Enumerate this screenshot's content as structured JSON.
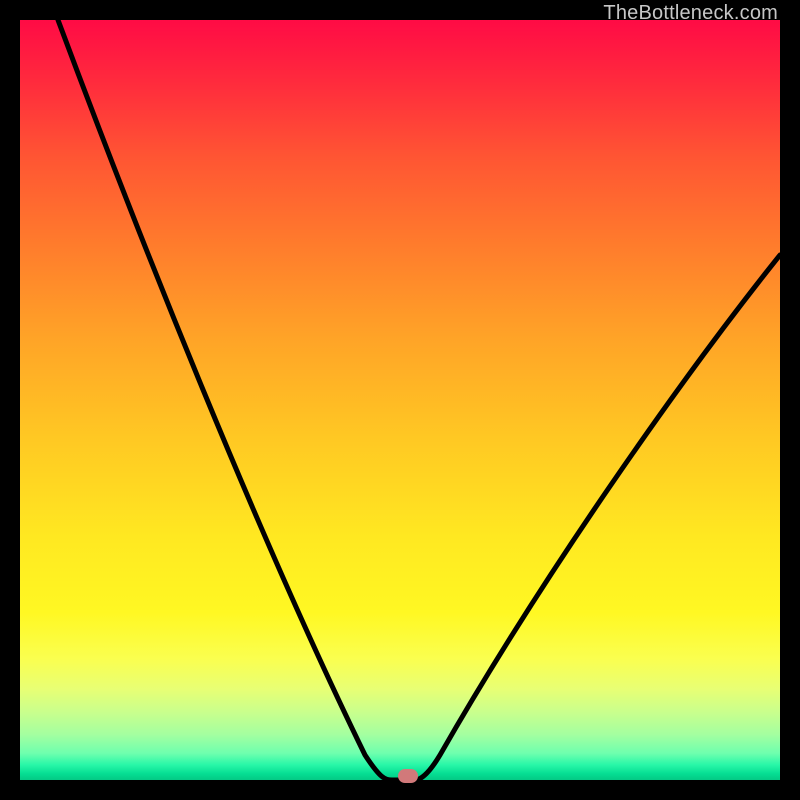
{
  "watermark": "TheBottleneck.com",
  "chart_data": {
    "type": "line",
    "title": "",
    "xlabel": "",
    "ylabel": "",
    "xlim": [
      0,
      100
    ],
    "ylim": [
      0,
      100
    ],
    "series": [
      {
        "name": "curve",
        "x": [
          5,
          10,
          15,
          20,
          25,
          30,
          35,
          40,
          45,
          48,
          50,
          52,
          55,
          60,
          65,
          70,
          75,
          80,
          85,
          90,
          95,
          100
        ],
        "values": [
          100,
          88,
          76,
          65,
          54,
          43,
          32,
          21,
          10,
          3,
          0,
          0,
          2,
          9,
          18,
          27,
          35,
          43,
          50,
          57,
          63,
          69
        ]
      }
    ],
    "marker": {
      "x": 51,
      "y": 0.5,
      "color": "#d1797a"
    },
    "gradient_stops": [
      {
        "pos": 0,
        "color": "#ff0b45"
      },
      {
        "pos": 8,
        "color": "#ff2a3d"
      },
      {
        "pos": 18,
        "color": "#ff5533"
      },
      {
        "pos": 30,
        "color": "#ff7d2c"
      },
      {
        "pos": 42,
        "color": "#ffa427"
      },
      {
        "pos": 55,
        "color": "#ffc823"
      },
      {
        "pos": 68,
        "color": "#ffe821"
      },
      {
        "pos": 78,
        "color": "#fff823"
      },
      {
        "pos": 84,
        "color": "#faff4f"
      },
      {
        "pos": 88,
        "color": "#e8ff74"
      },
      {
        "pos": 91,
        "color": "#caff8c"
      },
      {
        "pos": 94,
        "color": "#a4ffa0"
      },
      {
        "pos": 96.5,
        "color": "#6effae"
      },
      {
        "pos": 98,
        "color": "#28f7a8"
      },
      {
        "pos": 99.2,
        "color": "#05dd92"
      },
      {
        "pos": 100,
        "color": "#04c985"
      }
    ]
  }
}
